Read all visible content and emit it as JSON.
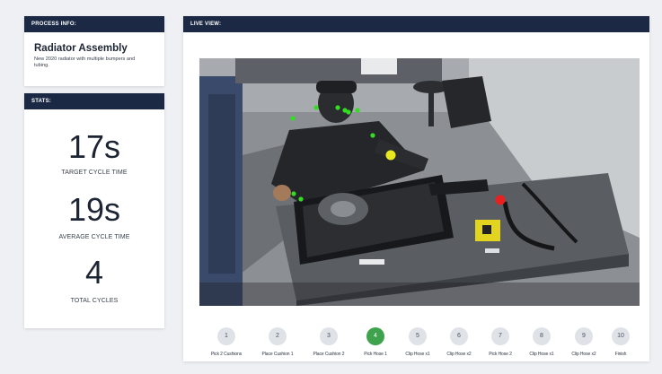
{
  "process": {
    "header": "PROCESS INFO:",
    "name": "Radiator Assembly",
    "description": "New 2020 radiator with multiple bumpers and tubing."
  },
  "stats": {
    "header": "STATS:",
    "target_value": "17s",
    "target_label": "TARGET CYCLE TIME",
    "average_value": "19s",
    "average_label": "AVERAGE CYCLE TIME",
    "cycles_value": "4",
    "cycles_label": "TOTAL CYCLES"
  },
  "live": {
    "header": "LIVE VIEW:"
  },
  "steps": [
    {
      "num": "1",
      "label": "Pick 2 Cushions",
      "active": false
    },
    {
      "num": "2",
      "label": "Place Cushion 1",
      "active": false
    },
    {
      "num": "3",
      "label": "Place Cushion 2",
      "active": false
    },
    {
      "num": "4",
      "label": "Pick Hose 1",
      "active": true
    },
    {
      "num": "5",
      "label": "Clip Hose x1",
      "active": false
    },
    {
      "num": "6",
      "label": "Clip Hose x2",
      "active": false
    },
    {
      "num": "7",
      "label": "Pick Hose 2",
      "active": false
    },
    {
      "num": "8",
      "label": "Clip Hose x1",
      "active": false
    },
    {
      "num": "9",
      "label": "Clip Hose x2",
      "active": false
    },
    {
      "num": "10",
      "label": "Finish",
      "active": false
    }
  ],
  "colors": {
    "header_bg": "#1b2944",
    "active_step": "#3fa34d",
    "inactive_step": "#dfe2e7",
    "pose_keypoint": "#33dd22",
    "tracker_yellow": "#e8e820",
    "tracker_red": "#e82020"
  }
}
